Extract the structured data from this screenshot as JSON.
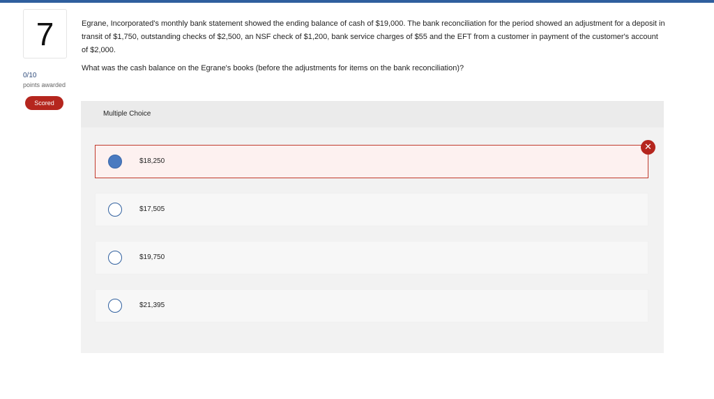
{
  "question": {
    "number": "7",
    "points": "0/10",
    "points_label": "points awarded",
    "status_badge": "Scored",
    "text": "Egrane, Incorporated's monthly bank statement showed the ending balance of cash of $19,000. The bank reconciliation for the period showed an adjustment for a deposit in transit of $1,750, outstanding checks of $2,500, an NSF check of $1,200, bank service charges of $55 and the EFT from a customer in payment of the customer's account of $2,000.",
    "prompt": "What was the cash balance on the Egrane's books (before the adjustments for items on the bank reconciliation)?"
  },
  "multiple_choice": {
    "header": "Multiple Choice",
    "choices": [
      {
        "label": "$18,250",
        "selected": true,
        "result": "incorrect"
      },
      {
        "label": "$17,505",
        "selected": false
      },
      {
        "label": "$19,750",
        "selected": false
      },
      {
        "label": "$21,395",
        "selected": false
      }
    ],
    "result_icon": "wrong-x-icon"
  },
  "colors": {
    "accent": "#2f5f9e",
    "error": "#b5261e",
    "selected_radio": "#4a7ac0"
  }
}
